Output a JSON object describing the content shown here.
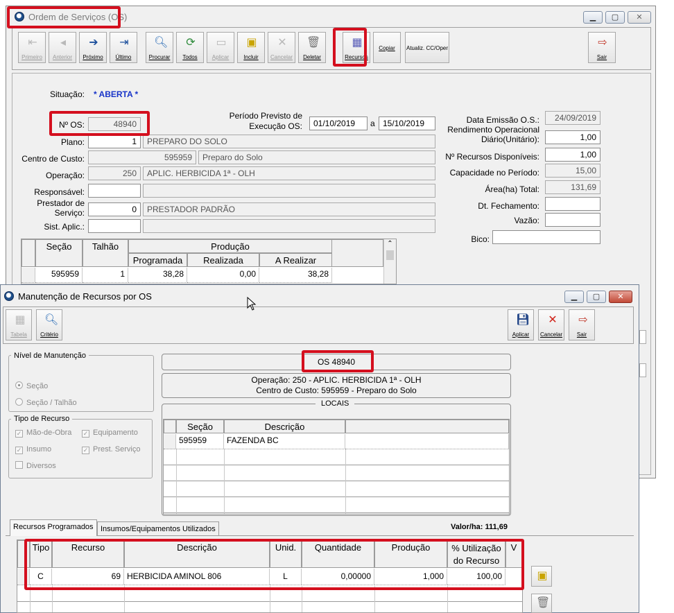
{
  "main_window": {
    "title": "Ordem de Serviços (OS)",
    "toolbar": [
      {
        "label": "Primeiro",
        "icon": "first-record-icon",
        "enabled": false
      },
      {
        "label": "Anterior",
        "icon": "previous-record-icon",
        "enabled": false
      },
      {
        "label": "Próximo",
        "icon": "next-record-icon",
        "enabled": true
      },
      {
        "label": "Último",
        "icon": "last-record-icon",
        "enabled": true
      },
      {
        "label": "Procurar",
        "icon": "search-icon",
        "enabled": true
      },
      {
        "label": "Todos",
        "icon": "refresh-all-icon",
        "enabled": true
      },
      {
        "label": "Aplicar",
        "icon": "apply-icon",
        "enabled": false
      },
      {
        "label": "Incluir",
        "icon": "new-record-icon",
        "enabled": true
      },
      {
        "label": "Cancelar",
        "icon": "cancel-icon",
        "enabled": false
      },
      {
        "label": "Deletar",
        "icon": "trash-icon",
        "enabled": true
      },
      {
        "label": "Recursos",
        "icon": "grid-icon",
        "enabled": true
      },
      {
        "label": "Copiar",
        "icon": "",
        "enabled": true
      },
      {
        "label": "Atualiz. CC/Oper",
        "icon": "",
        "enabled": true
      },
      {
        "label": "Sair",
        "icon": "exit-door-icon",
        "enabled": true
      }
    ],
    "form": {
      "situacao_label": "Situação:",
      "situacao_value": "* ABERTA *",
      "numero_os_label": "Nº OS:",
      "numero_os_value": "48940",
      "periodo_label_1": "Período Previsto de",
      "periodo_label_2": "Execução OS:",
      "periodo_inicio": "01/10/2019",
      "periodo_sep": "a",
      "periodo_fim": "15/10/2019",
      "plano_label": "Plano:",
      "plano_code": "1",
      "plano_desc": "PREPARO DO SOLO",
      "centro_label": "Centro de Custo:",
      "centro_code": "595959",
      "centro_desc": "Preparo do Solo",
      "operacao_label": "Operação:",
      "operacao_code": "250",
      "operacao_desc": "APLIC. HERBICIDA 1ª - OLH",
      "responsavel_label": "Responsável:",
      "prestador_label_1": "Prestador de",
      "prestador_label_2": "Serviço:",
      "prestador_code": "0",
      "prestador_desc": "PRESTADOR PADRÃO",
      "sist_aplic_label": "Sist. Aplic.:",
      "data_emissao_label": "Data Emissão O.S.:",
      "data_emissao_value": "24/09/2019",
      "rendimento_label_1": "Rendimento Operacional",
      "rendimento_label_2": "Diário(Unitário):",
      "rendimento_value": "1,00",
      "recursos_disp_label": "Nº Recursos Disponíveis:",
      "recursos_disp_value": "1,00",
      "capacidade_label": "Capacidade no Período:",
      "capacidade_value": "15,00",
      "area_label": "Área(ha) Total:",
      "area_value": "131,69",
      "dt_fechamento_label": "Dt. Fechamento:",
      "vazao_label": "Vazão:",
      "bico_label": "Bico:"
    },
    "grid": {
      "col_secao": "Seção",
      "col_talhao": "Talhão",
      "col_producao": "Produção",
      "col_programada": "Programada",
      "col_realizada": "Realizada",
      "col_a_realizar": "A Realizar",
      "rows": [
        {
          "secao": "595959",
          "talhao": "1",
          "programada": "38,28",
          "realizada": "0,00",
          "a_realizar": "38,28"
        }
      ]
    }
  },
  "resource_window": {
    "title": "Manutenção de Recursos por OS",
    "toolbar_left": [
      {
        "label": "Tabela",
        "icon": "table-icon",
        "enabled": false
      },
      {
        "label": "Critério",
        "icon": "search-icon",
        "enabled": true
      }
    ],
    "toolbar_right": [
      {
        "label": "Aplicar",
        "icon": "save-disk-icon",
        "enabled": true
      },
      {
        "label": "Cancelar",
        "icon": "cancel-x-icon",
        "enabled": true
      },
      {
        "label": "Sair",
        "icon": "exit-door-icon",
        "enabled": true
      }
    ],
    "nivel_title": "Nível de Manutenção",
    "nivel_options": [
      "Seção",
      "Seção / Talhão"
    ],
    "tipo_title": "Tipo de Recurso",
    "tipo_options": [
      "Mão-de-Obra",
      "Equipamento",
      "Insumo",
      "Prest. Serviço",
      "Diversos"
    ],
    "os_label": "OS 48940",
    "operacao_line": "Operação: 250 - APLIC. HERBICIDA 1ª - OLH",
    "centro_line": "Centro de Custo: 595959 - Preparo do Solo",
    "locais_title": "LOCAIS",
    "locais_cols": [
      "Seção",
      "Descrição"
    ],
    "locais_rows": [
      {
        "secao": "595959",
        "descricao": "FAZENDA BC"
      }
    ],
    "tabs": [
      "Recursos Programados",
      "Insumos/Equipamentos Utilizados"
    ],
    "valor_ha": "Valor/ha:  111,69",
    "recursos_cols": {
      "tipo": "Tipo",
      "recurso": "Recurso",
      "descricao": "Descrição",
      "unid": "Unid.",
      "quantidade": "Quantidade",
      "producao": "Produção",
      "utilizacao_1": "% Utilização",
      "utilizacao_2": "do Recurso"
    },
    "recursos_rows": [
      {
        "tipo": "C",
        "recurso": "69",
        "descricao": "HERBICIDA AMINOL 806",
        "unid": "L",
        "quantidade": "0,00000",
        "producao": "1,000",
        "utilizacao": "100,00"
      }
    ]
  }
}
